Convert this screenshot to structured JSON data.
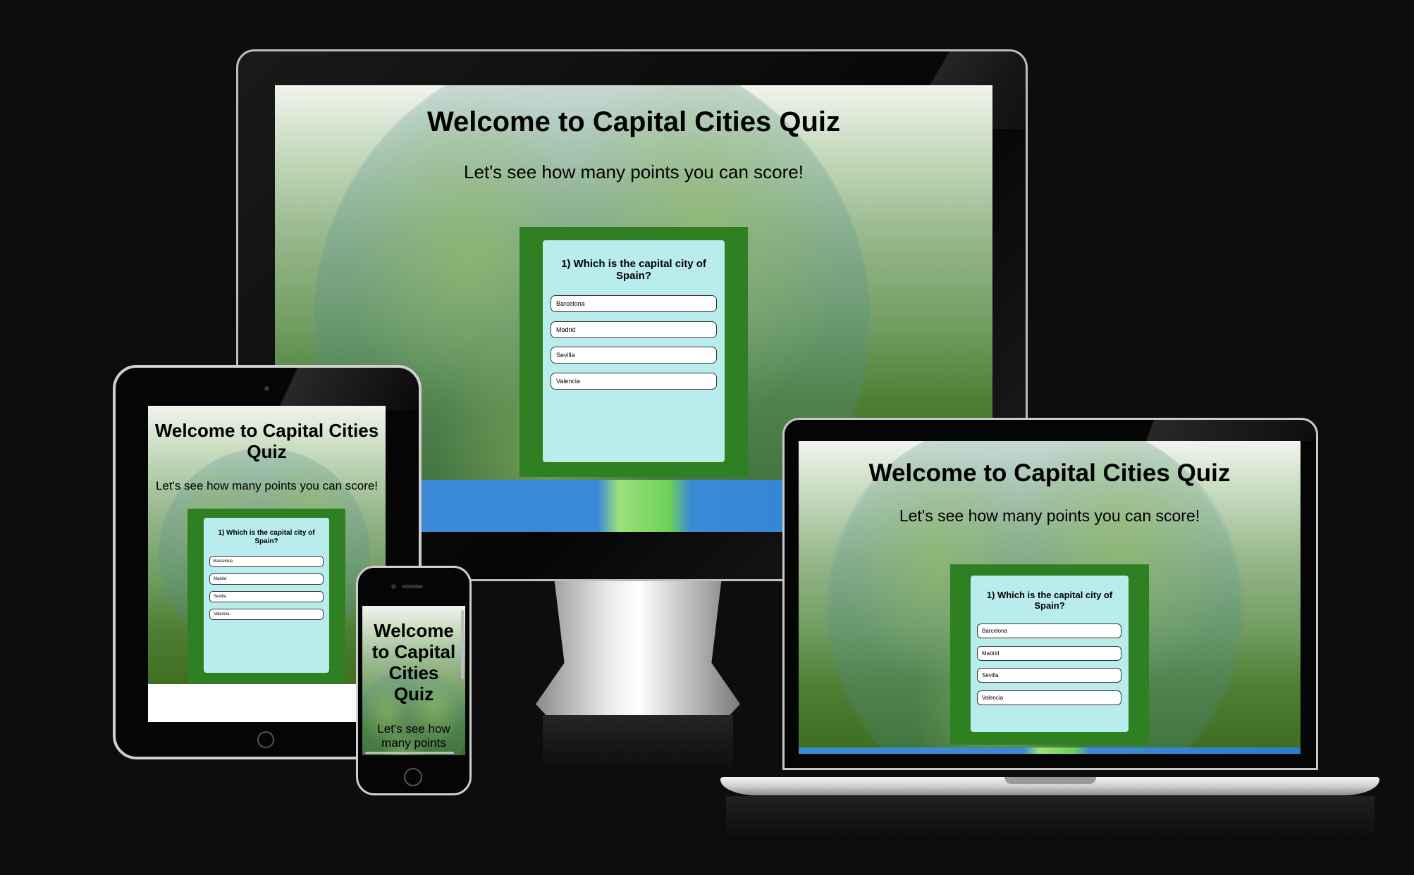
{
  "page": {
    "title": "Welcome to Capital Cities Quiz",
    "subtitle": "Let's see how many points you can score!"
  },
  "phone": {
    "title_lines": [
      "Welcome",
      "to Capital",
      "Cities",
      "Quiz"
    ],
    "subtitle_lines": [
      "Let's see how",
      "many points"
    ]
  },
  "tablet": {
    "title_lines": [
      "Welcome to Capital Cities",
      "Quiz"
    ]
  },
  "quiz": {
    "question": "1) Which is the capital city of Spain?",
    "question_lines": [
      "1) Which is the capital city of",
      "Spain?"
    ],
    "answers": [
      "Barcelona",
      "Madrid",
      "Sevilla",
      "Valencia"
    ]
  },
  "colors": {
    "page_background": "#0d0d0d",
    "quiz_border_green": "#2f8023",
    "quiz_panel": "#b9eced",
    "answer_button": "#ffffff"
  }
}
